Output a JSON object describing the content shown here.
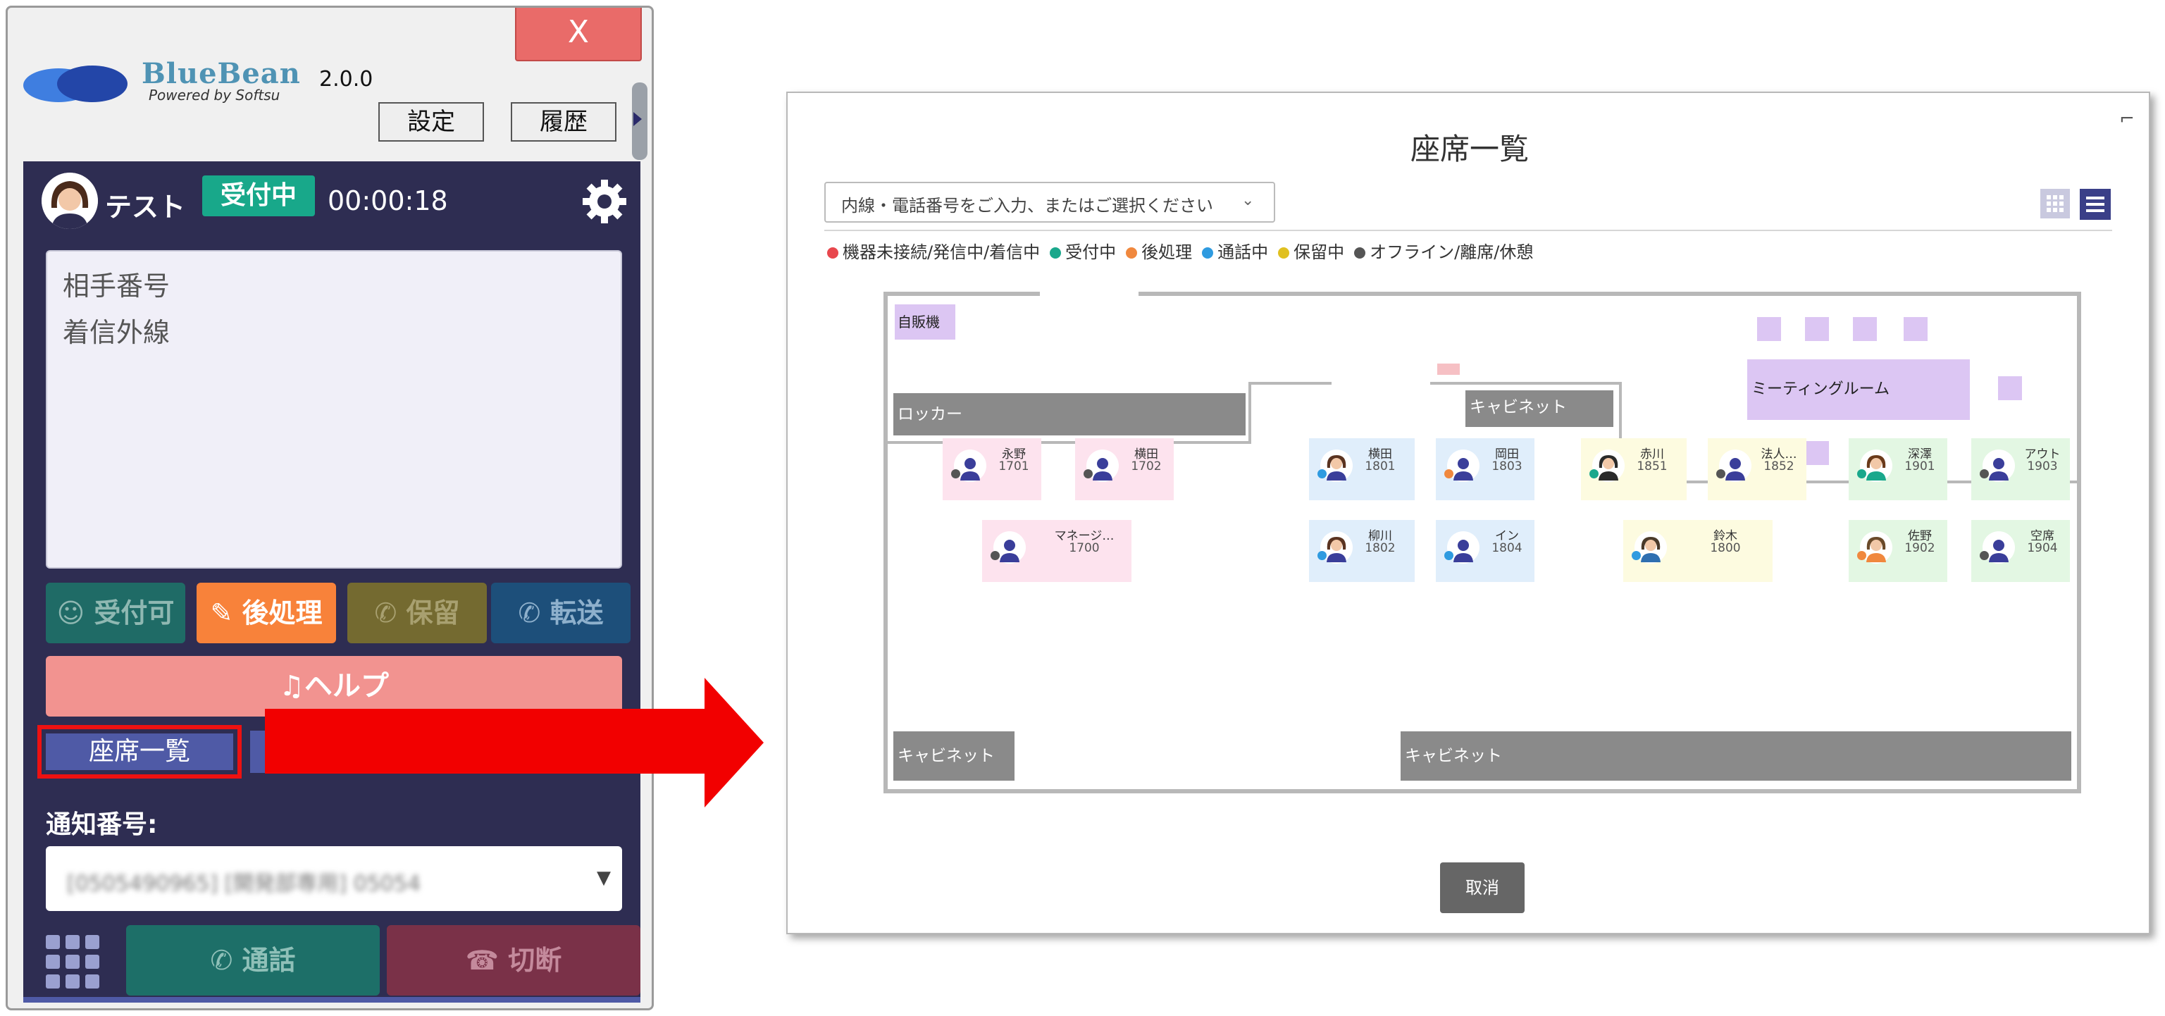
{
  "phone": {
    "close_label": "X",
    "brand": "BlueBean",
    "brand_sub": "Powered by Softsu",
    "version": "2.0.0",
    "settings_label": "設定",
    "history_label": "履歴",
    "user_name": "テスト",
    "status": "受付中",
    "timer": "00:00:18",
    "info_lines": [
      "相手番号",
      "着信外線"
    ],
    "actions": {
      "ready": "受付可",
      "after": "後処理",
      "hold": "保留",
      "transfer": "転送"
    },
    "help_label": "ヘルプ",
    "seat_list_label": "座席一覧",
    "notify_label": "通知番号:",
    "notify_value": "[0505490965] [開発部専用] 05054",
    "call_label": "通話",
    "hangup_label": "切断"
  },
  "dialog": {
    "title": "座席一覧",
    "search_placeholder": "内線・電話番号をご入力、またはご選択ください",
    "legend": [
      {
        "label": "機器未接続/発信中/着信中",
        "color": "#e8474d"
      },
      {
        "label": "受付中",
        "color": "#1aa88c"
      },
      {
        "label": "後処理",
        "color": "#f0883e"
      },
      {
        "label": "通話中",
        "color": "#2f9be0"
      },
      {
        "label": "保留中",
        "color": "#e0c020"
      },
      {
        "label": "オフライン/離席/休憩",
        "color": "#555555"
      }
    ],
    "areas": {
      "vending": "自販機",
      "locker": "ロッカー",
      "cabinet_top": "キャビネット",
      "meeting": "ミーティングルーム",
      "cabinet_bottom_left": "キャビネット",
      "cabinet_bottom_right": "キャビネット"
    },
    "seats": [
      {
        "name": "永野",
        "ext": "1701",
        "dot": "#555555",
        "bg": "#fde3ee",
        "avatar": "generic"
      },
      {
        "name": "横田",
        "ext": "1702",
        "dot": "#555555",
        "bg": "#fde3ee",
        "avatar": "generic"
      },
      {
        "name": "マネージ…",
        "ext": "1700",
        "dot": "#555555",
        "bg": "#fde3ee",
        "avatar": "generic"
      },
      {
        "name": "横田",
        "ext": "1801",
        "dot": "#2f9be0",
        "bg": "#e0eefb",
        "avatar": "woman"
      },
      {
        "name": "岡田",
        "ext": "1803",
        "dot": "#f0883e",
        "bg": "#e0eefb",
        "avatar": "generic"
      },
      {
        "name": "柳川",
        "ext": "1802",
        "dot": "#2f9be0",
        "bg": "#e0eefb",
        "avatar": "woman"
      },
      {
        "name": "イン",
        "ext": "1804",
        "dot": "#2f9be0",
        "bg": "#e0eefb",
        "avatar": "generic"
      },
      {
        "name": "赤川",
        "ext": "1851",
        "dot": "#1aa88c",
        "bg": "#fdfbe0",
        "avatar": "man"
      },
      {
        "name": "法人…",
        "ext": "1852",
        "dot": "#555555",
        "bg": "#fdfbe0",
        "avatar": "generic"
      },
      {
        "name": "鈴木",
        "ext": "1800",
        "dot": "#2f9be0",
        "bg": "#fdfbe0",
        "avatar": "man2"
      },
      {
        "name": "深澤",
        "ext": "1901",
        "dot": "#1aa88c",
        "bg": "#e3f7e3",
        "avatar": "woman2"
      },
      {
        "name": "アウト",
        "ext": "1903",
        "dot": "#555555",
        "bg": "#e3f7e3",
        "avatar": "generic"
      },
      {
        "name": "佐野",
        "ext": "1902",
        "dot": "#f0883e",
        "bg": "#e3f7e3",
        "avatar": "man3"
      },
      {
        "name": "空席",
        "ext": "1904",
        "dot": "#555555",
        "bg": "#e3f7e3",
        "avatar": "generic"
      }
    ],
    "cancel_label": "取消"
  },
  "icons": {
    "gear": "gear-icon",
    "bell": "bell-icon",
    "phone": "phone-icon",
    "dialpad": "dialpad-icon",
    "grid_view": "grid-view-icon",
    "list_view": "list-view-icon",
    "arrow": "arrow-right-icon"
  }
}
